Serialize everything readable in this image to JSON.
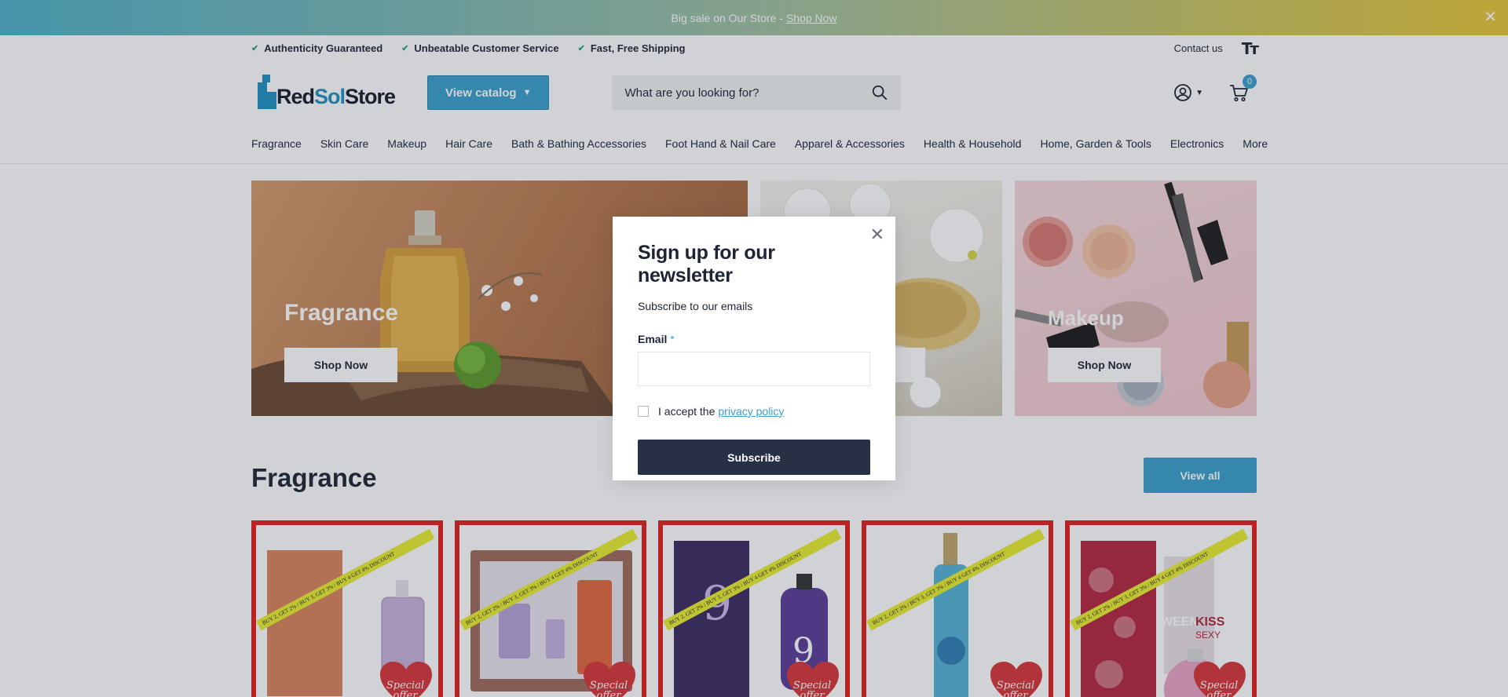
{
  "announcement": {
    "text": "Big sale on Our Store -",
    "link": "Shop Now"
  },
  "usp": {
    "items": [
      "Authenticity Guaranteed",
      "Unbeatable Customer Service",
      "Fast, Free Shipping"
    ],
    "contact": "Contact us",
    "text_size_icon": "Tт"
  },
  "header": {
    "logo": {
      "part1": "Red",
      "part2": "Sol",
      "part3": "Store"
    },
    "catalog_button": "View catalog",
    "search_placeholder": "What are you looking for?",
    "cart_count": "0"
  },
  "nav": [
    "Fragrance",
    "Skin Care",
    "Makeup",
    "Hair Care",
    "Bath & Bathing Accessories",
    "Foot Hand & Nail Care",
    "Apparel & Accessories",
    "Health & Household",
    "Home, Garden & Tools",
    "Electronics",
    "More"
  ],
  "tiles": [
    {
      "title": "Fragrance",
      "button": "Shop Now"
    },
    {
      "title": "",
      "button": ""
    },
    {
      "title": "Makeup",
      "button": "Shop Now"
    }
  ],
  "section": {
    "title": "Fragrance",
    "view_all": "View all"
  },
  "products": [
    {
      "ribbon": "BUY 2, GET 2% / BUY 3, GET 3% / BUY 4 GET 4% DISCOUNT",
      "badge": "Special offer",
      "bottle_color": "#c7b3dc",
      "box_color": "#d9825a"
    },
    {
      "ribbon": "BUY 2, GET 2% / BUY 3, GET 3% / BUY 4 GET 4% DISCOUNT",
      "badge": "Special offer",
      "bottle_color": "#b7a2d6",
      "box_color": "#a06a5a"
    },
    {
      "ribbon": "BUY 2, GET 2% / BUY 3, GET 3% / BUY 4 GET 4% DISCOUNT",
      "badge": "Special offer",
      "bottle_color": "#5b3c98",
      "box_color": "#3a2a60"
    },
    {
      "ribbon": "BUY 2, GET 2% / BUY 3, GET 3% / BUY 4 GET 4% DISCOUNT",
      "badge": "Special offer",
      "bottle_color": "#54b3d6",
      "box_color": "#ffffff"
    },
    {
      "ribbon": "BUY 2, GET 2% / BUY 3, GET 3% / BUY 4 GET 4% DISCOUNT",
      "badge": "Special offer",
      "bottle_color": "#e9a3c6",
      "box_color": "#b4263e"
    }
  ],
  "modal": {
    "title": "Sign up for our newsletter",
    "subtitle": "Subscribe to our emails",
    "email_label": "Email",
    "required_mark": "*",
    "accept_text": "I accept the",
    "privacy_link": "privacy policy",
    "subscribe_button": "Subscribe"
  }
}
